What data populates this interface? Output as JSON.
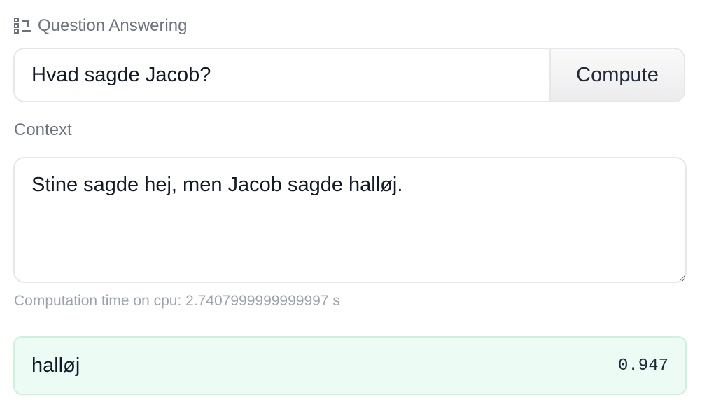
{
  "task": {
    "icon": "question-answering-icon",
    "title": "Question Answering"
  },
  "question": {
    "value": "Hvad sagde Jacob?",
    "button_label": "Compute"
  },
  "context": {
    "label": "Context",
    "value": "Stine sagde hej, men Jacob sagde halløj."
  },
  "computation": {
    "text": "Computation time on cpu: 2.7407999999999997 s"
  },
  "answer": {
    "text": "halløj",
    "score": "0.947",
    "background_color": "#ecfbf3"
  }
}
